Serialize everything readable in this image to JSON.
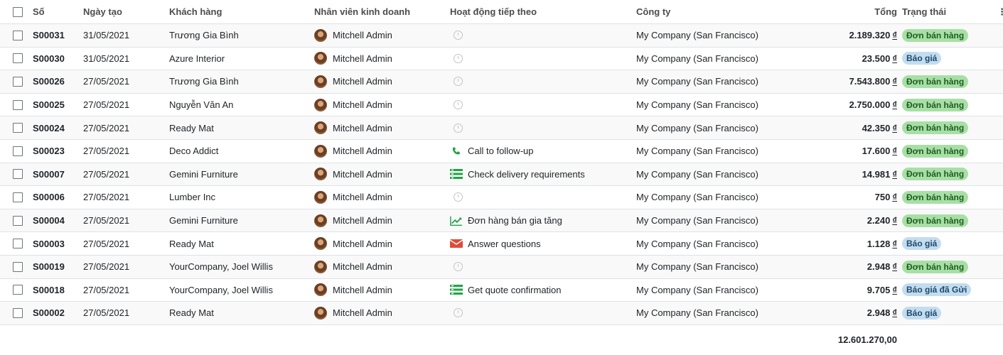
{
  "headers": {
    "number": "Số",
    "date": "Ngày tạo",
    "customer": "Khách hàng",
    "salesperson": "Nhân viên kinh doanh",
    "activity": "Hoạt động tiếp theo",
    "company": "Công ty",
    "total": "Tổng",
    "status": "Trạng thái"
  },
  "currency_symbol": "₫",
  "rows": [
    {
      "number": "S00031",
      "date": "31/05/2021",
      "customer": "Trương Gia Bình",
      "salesperson": "Mitchell Admin",
      "activity": "",
      "activity_icon": "clock-icon",
      "company": "My Company (San Francisco)",
      "total": "2.189.320",
      "status": "Đơn bán hàng",
      "status_type": "sale"
    },
    {
      "number": "S00030",
      "date": "31/05/2021",
      "customer": "Azure Interior",
      "salesperson": "Mitchell Admin",
      "activity": "",
      "activity_icon": "clock-icon",
      "company": "My Company (San Francisco)",
      "total": "23.500",
      "status": "Báo giá",
      "status_type": "quote"
    },
    {
      "number": "S00026",
      "date": "27/05/2021",
      "customer": "Trương Gia Bình",
      "salesperson": "Mitchell Admin",
      "activity": "",
      "activity_icon": "clock-icon",
      "company": "My Company (San Francisco)",
      "total": "7.543.800",
      "status": "Đơn bán hàng",
      "status_type": "sale"
    },
    {
      "number": "S00025",
      "date": "27/05/2021",
      "customer": "Nguyễn Văn An",
      "salesperson": "Mitchell Admin",
      "activity": "",
      "activity_icon": "clock-icon",
      "company": "My Company (San Francisco)",
      "total": "2.750.000",
      "status": "Đơn bán hàng",
      "status_type": "sale"
    },
    {
      "number": "S00024",
      "date": "27/05/2021",
      "customer": "Ready Mat",
      "salesperson": "Mitchell Admin",
      "activity": "",
      "activity_icon": "clock-icon",
      "company": "My Company (San Francisco)",
      "total": "42.350",
      "status": "Đơn bán hàng",
      "status_type": "sale"
    },
    {
      "number": "S00023",
      "date": "27/05/2021",
      "customer": "Deco Addict",
      "salesperson": "Mitchell Admin",
      "activity": "Call to follow-up",
      "activity_icon": "phone-icon",
      "company": "My Company (San Francisco)",
      "total": "17.600",
      "status": "Đơn bán hàng",
      "status_type": "sale"
    },
    {
      "number": "S00007",
      "date": "27/05/2021",
      "customer": "Gemini Furniture",
      "salesperson": "Mitchell Admin",
      "activity": "Check delivery requirements",
      "activity_icon": "tasks-icon",
      "company": "My Company (San Francisco)",
      "total": "14.981",
      "status": "Đơn bán hàng",
      "status_type": "sale"
    },
    {
      "number": "S00006",
      "date": "27/05/2021",
      "customer": "Lumber Inc",
      "salesperson": "Mitchell Admin",
      "activity": "",
      "activity_icon": "clock-icon",
      "company": "My Company (San Francisco)",
      "total": "750",
      "status": "Đơn bán hàng",
      "status_type": "sale"
    },
    {
      "number": "S00004",
      "date": "27/05/2021",
      "customer": "Gemini Furniture",
      "salesperson": "Mitchell Admin",
      "activity": "Đơn hàng bán gia tăng",
      "activity_icon": "upsell-chart-icon",
      "company": "My Company (San Francisco)",
      "total": "2.240",
      "status": "Đơn bán hàng",
      "status_type": "sale"
    },
    {
      "number": "S00003",
      "date": "27/05/2021",
      "customer": "Ready Mat",
      "salesperson": "Mitchell Admin",
      "activity": "Answer questions",
      "activity_icon": "envelope-icon",
      "company": "My Company (San Francisco)",
      "total": "1.128",
      "status": "Báo giá",
      "status_type": "quote"
    },
    {
      "number": "S00019",
      "date": "27/05/2021",
      "customer": "YourCompany, Joel Willis",
      "salesperson": "Mitchell Admin",
      "activity": "",
      "activity_icon": "clock-icon",
      "company": "My Company (San Francisco)",
      "total": "2.948",
      "status": "Đơn bán hàng",
      "status_type": "sale"
    },
    {
      "number": "S00018",
      "date": "27/05/2021",
      "customer": "YourCompany, Joel Willis",
      "salesperson": "Mitchell Admin",
      "activity": "Get quote confirmation",
      "activity_icon": "tasks-icon",
      "company": "My Company (San Francisco)",
      "total": "9.705",
      "status": "Báo giá đã Gửi",
      "status_type": "sent"
    },
    {
      "number": "S00002",
      "date": "27/05/2021",
      "customer": "Ready Mat",
      "salesperson": "Mitchell Admin",
      "activity": "",
      "activity_icon": "clock-icon",
      "company": "My Company (San Francisco)",
      "total": "2.948",
      "status": "Báo giá",
      "status_type": "quote"
    }
  ],
  "footer_total": "12.601.270,00",
  "colors": {
    "sale_badge": "#a8dfa6",
    "quote_badge": "#c3dcef",
    "activity_green": "#21a346",
    "activity_red": "#e04b3a"
  }
}
